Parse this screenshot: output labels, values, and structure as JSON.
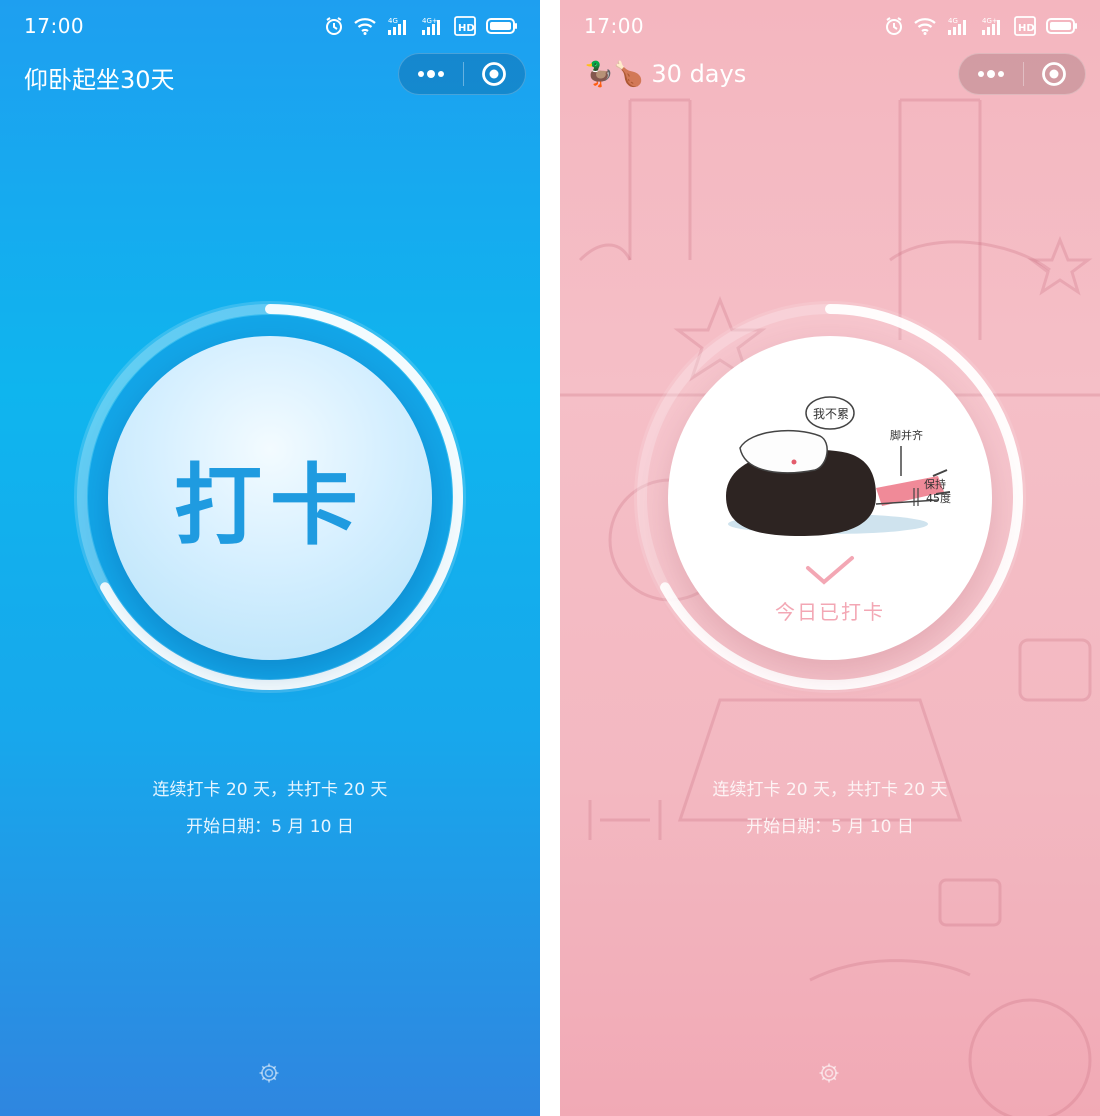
{
  "left_screen": {
    "status_time": "17:00",
    "status_icons": [
      "alarm-icon",
      "wifi-icon",
      "signal-4g-icon",
      "signal-4g-plus-icon",
      "hd-icon",
      "battery-icon"
    ],
    "title": "仰卧起坐30天",
    "checkin_label": "打卡",
    "progress": 0.67,
    "stats_line1": "连续打卡 20 天，共打卡 20 天",
    "stats_line2": "开始日期：5 月 10 日",
    "accent_color": "#1f9be0"
  },
  "right_screen": {
    "status_time": "17:00",
    "status_icons": [
      "alarm-icon",
      "wifi-icon",
      "signal-4g-icon",
      "signal-4g-plus-icon",
      "hd-icon",
      "battery-icon"
    ],
    "title_emoji": "🦆🍗",
    "title": "30 days",
    "done_label": "今日已打卡",
    "progress": 0.67,
    "illustration_bubble": "我不累",
    "illustration_label_feet": "脚并齐",
    "illustration_label_hold": "保持",
    "illustration_label_angle": "45度",
    "stats_line1": "连续打卡 20 天，共打卡 20 天",
    "stats_line2": "开始日期：5 月 10 日",
    "accent_color": "#f3a7b4"
  }
}
